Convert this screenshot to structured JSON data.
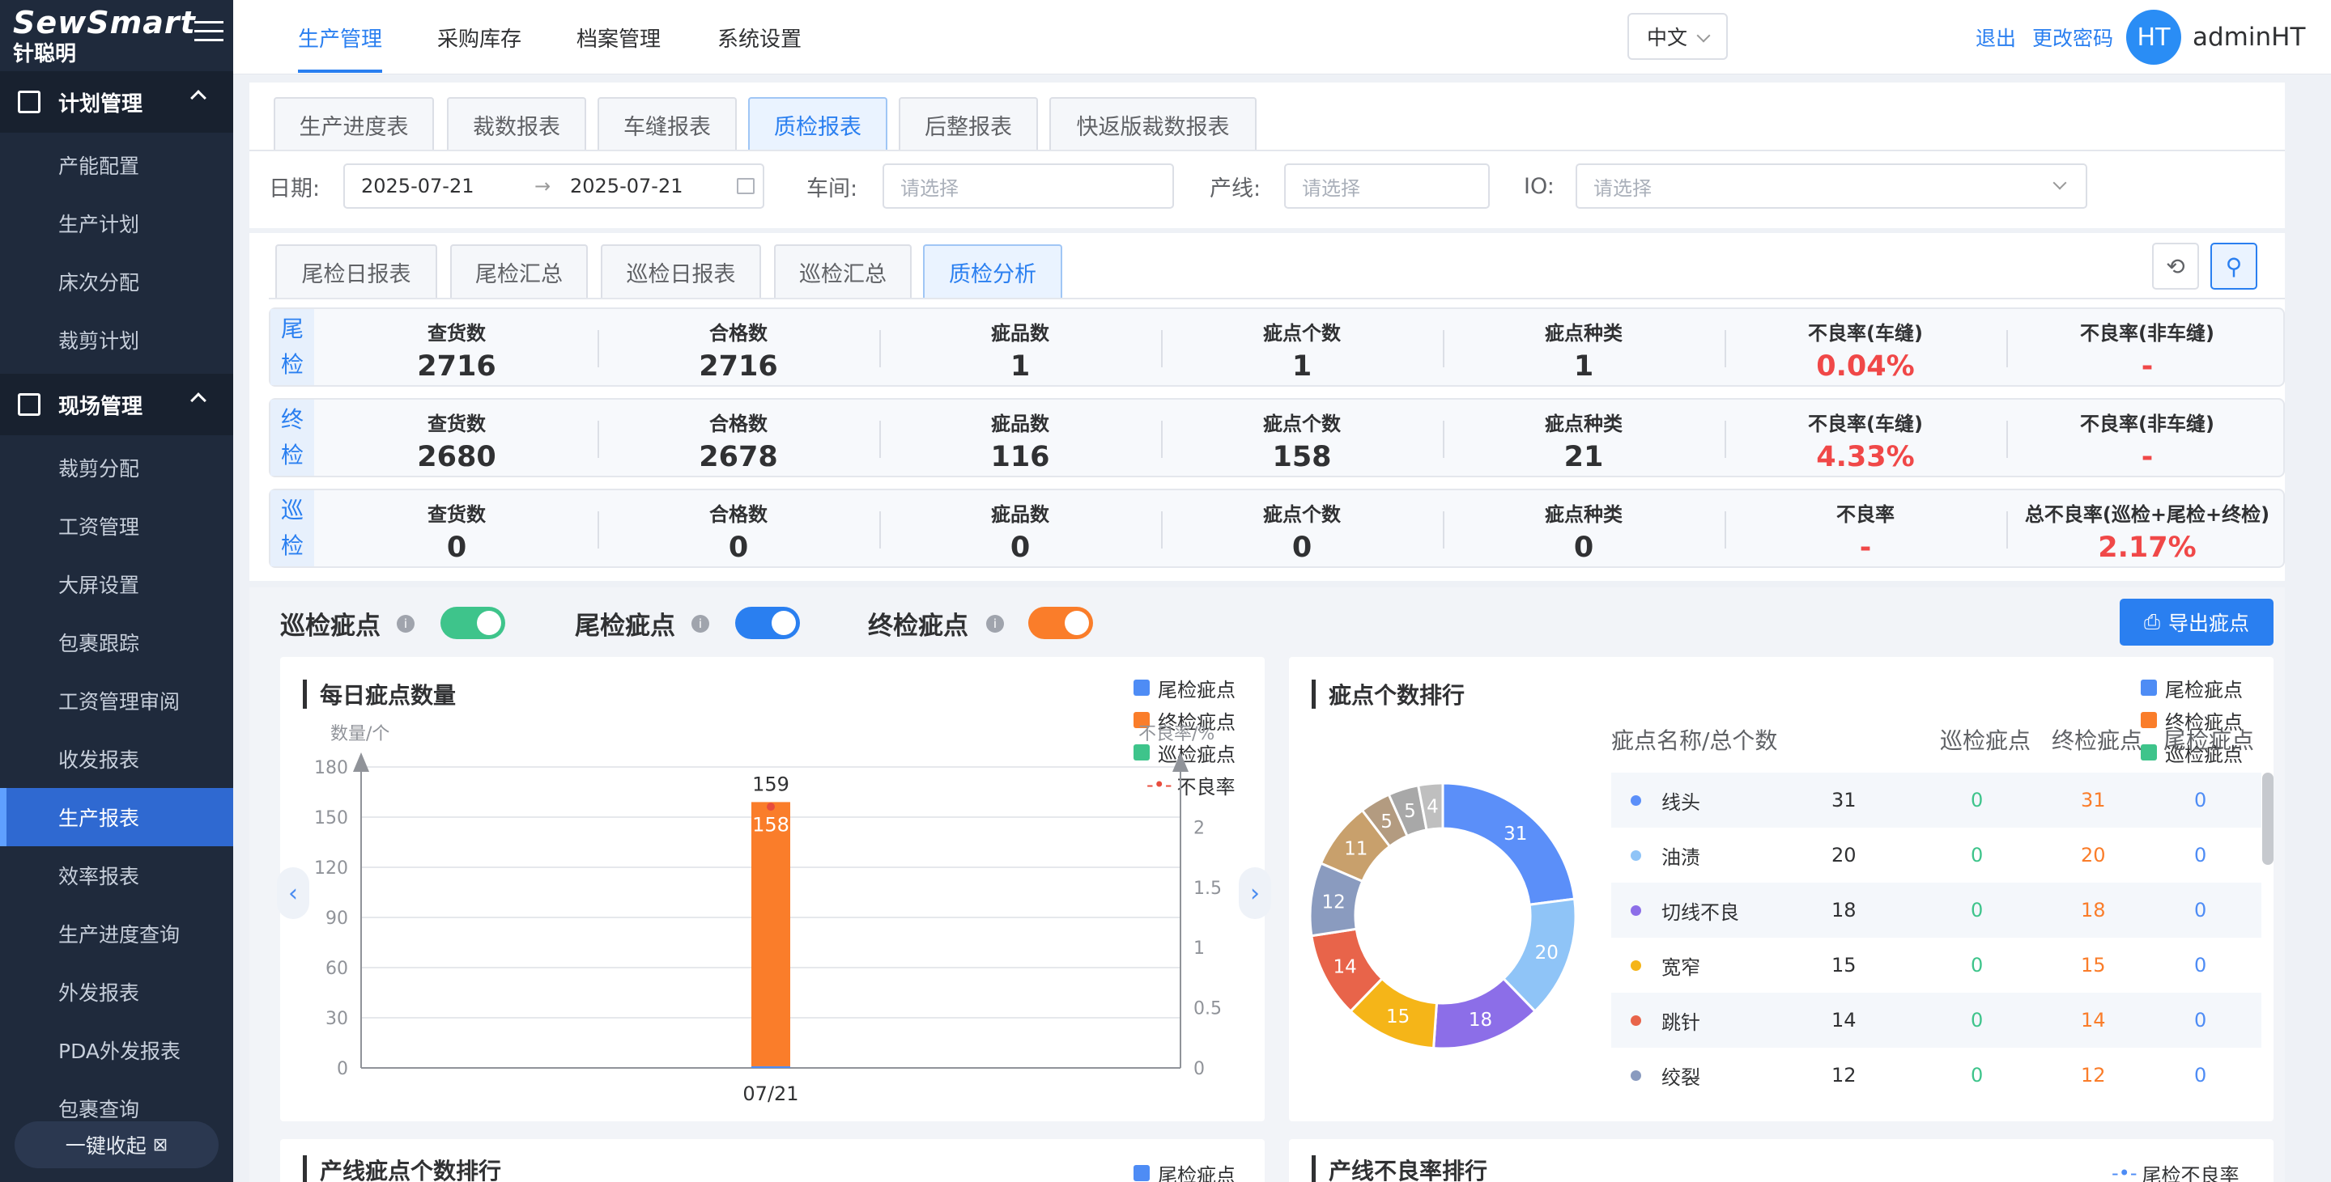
{
  "brand": {
    "name": "SewSmart",
    "subname": "针聪明"
  },
  "sidebar": {
    "groups": [
      {
        "label": "计划管理",
        "items": [
          "产能配置",
          "生产计划",
          "床次分配",
          "裁剪计划"
        ]
      },
      {
        "label": "现场管理",
        "items": [
          "裁剪分配",
          "工资管理",
          "大屏设置",
          "包裹跟踪",
          "工资管理审阅",
          "收发报表",
          "生产报表",
          "效率报表",
          "生产进度查询",
          "外发报表",
          "PDA外发报表",
          "包裹查询"
        ]
      }
    ],
    "active_item": "生产报表",
    "collapse_label": "一键收起"
  },
  "topnav": {
    "tabs": [
      "生产管理",
      "采购库存",
      "档案管理",
      "系统设置"
    ],
    "active": "生产管理",
    "language": "中文",
    "logout": "退出",
    "change_password": "更改密码",
    "avatar": "HT",
    "username": "adminHT"
  },
  "report_tabs": [
    "生产进度表",
    "裁数报表",
    "车缝报表",
    "质检报表",
    "后整报表",
    "快返版裁数报表"
  ],
  "report_active": "质检报表",
  "filters": {
    "date_label": "日期:",
    "date_start": "2025-07-21",
    "date_end": "2025-07-21",
    "workshop_label": "车间:",
    "line_label": "产线:",
    "io_label": "IO:",
    "placeholder": "请选择"
  },
  "sub_tabs": [
    "尾检日报表",
    "尾检汇总",
    "巡检日报表",
    "巡检汇总",
    "质检分析"
  ],
  "sub_active": "质检分析",
  "stats": [
    {
      "tag": [
        "尾",
        "检"
      ],
      "cells": [
        {
          "label": "查货数",
          "value": "2716"
        },
        {
          "label": "合格数",
          "value": "2716"
        },
        {
          "label": "疵品数",
          "value": "1"
        },
        {
          "label": "疵点个数",
          "value": "1"
        },
        {
          "label": "疵点种类",
          "value": "1"
        },
        {
          "label": "不良率(车缝)",
          "value": "0.04%"
        },
        {
          "label": "不良率(非车缝)",
          "value": "-"
        }
      ]
    },
    {
      "tag": [
        "终",
        "检"
      ],
      "cells": [
        {
          "label": "查货数",
          "value": "2680"
        },
        {
          "label": "合格数",
          "value": "2678"
        },
        {
          "label": "疵品数",
          "value": "116"
        },
        {
          "label": "疵点个数",
          "value": "158"
        },
        {
          "label": "疵点种类",
          "value": "21"
        },
        {
          "label": "不良率(车缝)",
          "value": "4.33%"
        },
        {
          "label": "不良率(非车缝)",
          "value": "-"
        }
      ]
    },
    {
      "tag": [
        "巡",
        "检"
      ],
      "cells": [
        {
          "label": "查货数",
          "value": "0"
        },
        {
          "label": "合格数",
          "value": "0"
        },
        {
          "label": "疵品数",
          "value": "0"
        },
        {
          "label": "疵点个数",
          "value": "0"
        },
        {
          "label": "疵点种类",
          "value": "0"
        },
        {
          "label": "不良率",
          "value": "-"
        },
        {
          "label": "总不良率(巡检+尾检+终检)",
          "value": "2.17%"
        }
      ]
    }
  ],
  "toggles": [
    {
      "label": "巡检疵点",
      "on": true,
      "color": "#3ec48b"
    },
    {
      "label": "尾检疵点",
      "on": true,
      "color": "#2a7ff0"
    },
    {
      "label": "终检疵点",
      "on": true,
      "color": "#fa7d2a"
    }
  ],
  "export_label": "导出疵点",
  "colors": {
    "tail": "#4e8cf5",
    "final": "#fa7d2a",
    "patrol": "#3ec48b",
    "rate": "#e84c3d"
  },
  "daily_chart": {
    "title": "每日疵点数量",
    "legend": [
      "尾检疵点",
      "终检疵点",
      "巡检疵点",
      "不良率"
    ],
    "ylabel": "数量/个",
    "y2label": "不良率/%"
  },
  "rank_chart": {
    "title": "疵点个数排行",
    "legend": [
      "尾检疵点",
      "终检疵点",
      "巡检疵点"
    ],
    "columns": [
      "疵点名称/总个数",
      "巡检疵点",
      "终检疵点",
      "尾检疵点"
    ],
    "rows": [
      {
        "name": "线头",
        "total": "31",
        "patrol": "0",
        "final": "31",
        "tail": "0",
        "color": "#5b8ff9"
      },
      {
        "name": "油渍",
        "total": "20",
        "patrol": "0",
        "final": "20",
        "tail": "0",
        "color": "#8fc4f7"
      },
      {
        "name": "切线不良",
        "total": "18",
        "patrol": "0",
        "final": "18",
        "tail": "0",
        "color": "#8c6ee8"
      },
      {
        "name": "宽窄",
        "total": "15",
        "patrol": "0",
        "final": "15",
        "tail": "0",
        "color": "#f5b518"
      },
      {
        "name": "跳针",
        "total": "14",
        "patrol": "0",
        "final": "14",
        "tail": "0",
        "color": "#e8644a"
      },
      {
        "name": "绞裂",
        "total": "12",
        "patrol": "0",
        "final": "12",
        "tail": "0",
        "color": "#8a9bbf"
      }
    ]
  },
  "line_rank_title": "产线疵点个数排行",
  "line_rank_legend": "尾检疵点",
  "line_rate_title": "产线不良率排行",
  "line_rate_legend": "尾检不良率",
  "chart_data": [
    {
      "type": "bar",
      "title": "每日疵点数量",
      "categories": [
        "07/21"
      ],
      "series": [
        {
          "name": "尾检疵点",
          "values": [
            1
          ]
        },
        {
          "name": "终检疵点",
          "values": [
            158
          ]
        },
        {
          "name": "巡检疵点",
          "values": [
            0
          ]
        },
        {
          "name": "不良率",
          "values": [
            2.17
          ]
        }
      ],
      "data_labels": [
        {
          "stack_total": 159,
          "final": 158
        }
      ],
      "ylabel": "数量/个",
      "y2label": "不良率/%",
      "ylim": [
        0,
        180
      ],
      "yticks": [
        0,
        30,
        60,
        90,
        120,
        150,
        180
      ],
      "y2lim": [
        0,
        2.5
      ],
      "y2ticks": [
        0,
        0.5,
        1,
        1.5,
        2
      ],
      "legend_placement": "top-right",
      "grid": true
    },
    {
      "type": "pie",
      "title": "疵点个数排行",
      "labels": [
        "线头",
        "油渍",
        "切线不良",
        "宽窄",
        "跳针",
        "绞裂",
        "",
        "",
        "",
        ""
      ],
      "values": [
        31,
        20,
        18,
        15,
        14,
        12,
        11,
        5,
        5,
        4
      ],
      "colors": [
        "#5b8ff9",
        "#8fc4f7",
        "#8c6ee8",
        "#f5b518",
        "#e8644a",
        "#8a9bbf",
        "#c8a06c",
        "#b39b80",
        "#a8a8a8",
        "#bfbfbf"
      ],
      "donut": true
    }
  ]
}
